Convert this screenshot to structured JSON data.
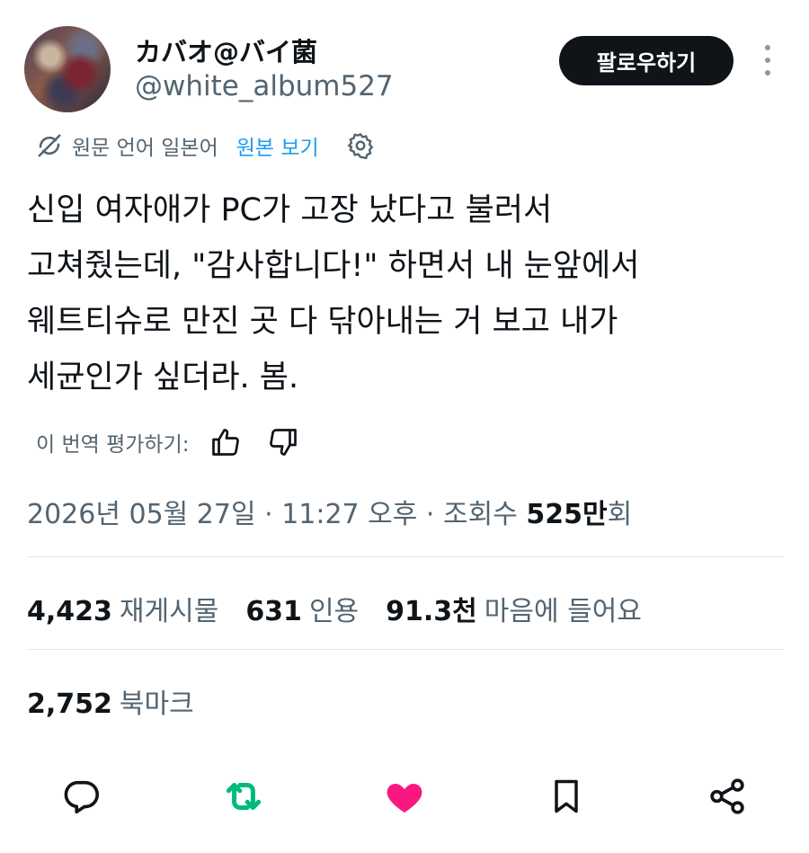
{
  "author": {
    "display_name": "カバオ@バイ菌",
    "handle": "@white_album527",
    "follow_label": "팔로우하기"
  },
  "translation": {
    "source_label": "원문 언어 일본어",
    "show_original_label": "원본 보기"
  },
  "tweet": {
    "text": "신입 여자애가 PC가 고장 났다고 불러서\n고쳐줬는데, \"감사합니다!\" 하면서 내 눈앞에서\n웨트티슈로 만진 곳 다 닦아내는 거 보고 내가\n세균인가 싶더라. 봄."
  },
  "rating": {
    "label": "이 번역 평가하기:"
  },
  "meta": {
    "date": "2026년 05월 27일",
    "sep1": " · ",
    "time": "11:27 오후",
    "sep2": " · ",
    "views_prefix": "조회수 ",
    "views_count": "525만",
    "views_suffix": "회"
  },
  "stats": {
    "reposts_count": "4,423",
    "reposts_label": "재게시물",
    "quotes_count": "631",
    "quotes_label": "인용",
    "likes_count": "91.3천",
    "likes_label": "마음에 들어요",
    "bookmarks_count": "2,752",
    "bookmarks_label": "북마크"
  },
  "colors": {
    "accent": "#1d9bf0",
    "repost_green": "#00ba7c",
    "like_pink": "#f91880",
    "muted": "#536471"
  },
  "icons": [
    "translate-off-icon",
    "gear-icon",
    "thumbs-up-icon",
    "thumbs-down-icon",
    "reply-icon",
    "repost-icon",
    "heart-icon",
    "bookmark-icon",
    "share-icon",
    "more-icon"
  ]
}
